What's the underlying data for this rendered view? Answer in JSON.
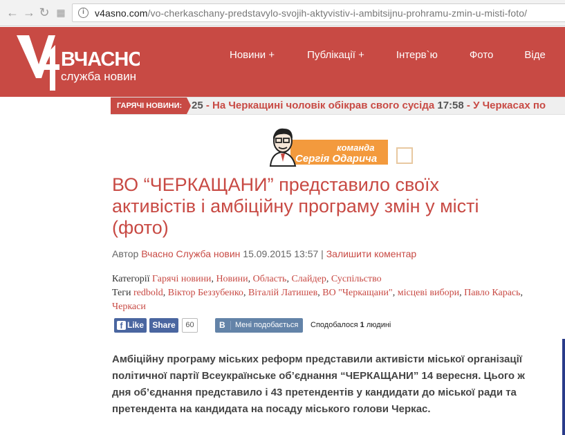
{
  "browser": {
    "url_host": "v4asno.com",
    "url_path": "/vo-cherkaschany-predstavylo-svojih-aktyvistiv-i-ambitsijnu-prohramu-zmin-u-misti-foto/"
  },
  "logo": {
    "mark": "V4",
    "name": "ВЧАСНО",
    "tagline": "служба новин"
  },
  "nav": {
    "items": [
      "Новини +",
      "Публікації +",
      "Інтерв`ю",
      "Фото",
      "Віде"
    ]
  },
  "ticker": {
    "label": "ГАРЯЧІ НОВИНИ:",
    "prefix": "25",
    "item1": "На Черкащині чоловік обікрав свого сусіда",
    "time2": "17:58",
    "item2": "У Черкасах по"
  },
  "banner": {
    "line1": "команда",
    "line2": "Сергія Одарича"
  },
  "article": {
    "title": "ВО “ЧЕРКАЩАНИ” представило своїх активістів і амбіційну програму змін у місті (фото)",
    "author_label": "Автор",
    "author": "Вчасно Служба новин",
    "date": "15.09.2015 13:57",
    "separator": "|",
    "comment_link": "Залишити коментар",
    "categories_label": "Категорії",
    "categories": [
      "Гарячі новини",
      "Новини",
      "Область",
      "Слайдер",
      "Суспільство"
    ],
    "tags_label": "Теги",
    "tags": [
      "redbold",
      "Віктор Беззубенко",
      "Віталій Латишев",
      "ВО \"Черкащани\"",
      "місцеві вибори",
      "Павло Карась",
      "Черкаси"
    ],
    "lead": "Амбіційну програму міських реформ представили активісти міської організації політичної партії Всеукраїнське об’єднання “ЧЕРКАЩАНИ” 14 вересня. Цього ж дня об’єднання представило і 43 претендентів у кандидати до міської ради та претендента на кандидата на посаду міського голови Черкас."
  },
  "social": {
    "fb_like": "Like",
    "fb_share": "Share",
    "fb_count": "60",
    "vk_logo": "B",
    "vk_label": "Мені подобається",
    "vk_liked_prefix": "Сподобалося",
    "vk_liked_count": "1",
    "vk_liked_suffix": "людині"
  }
}
